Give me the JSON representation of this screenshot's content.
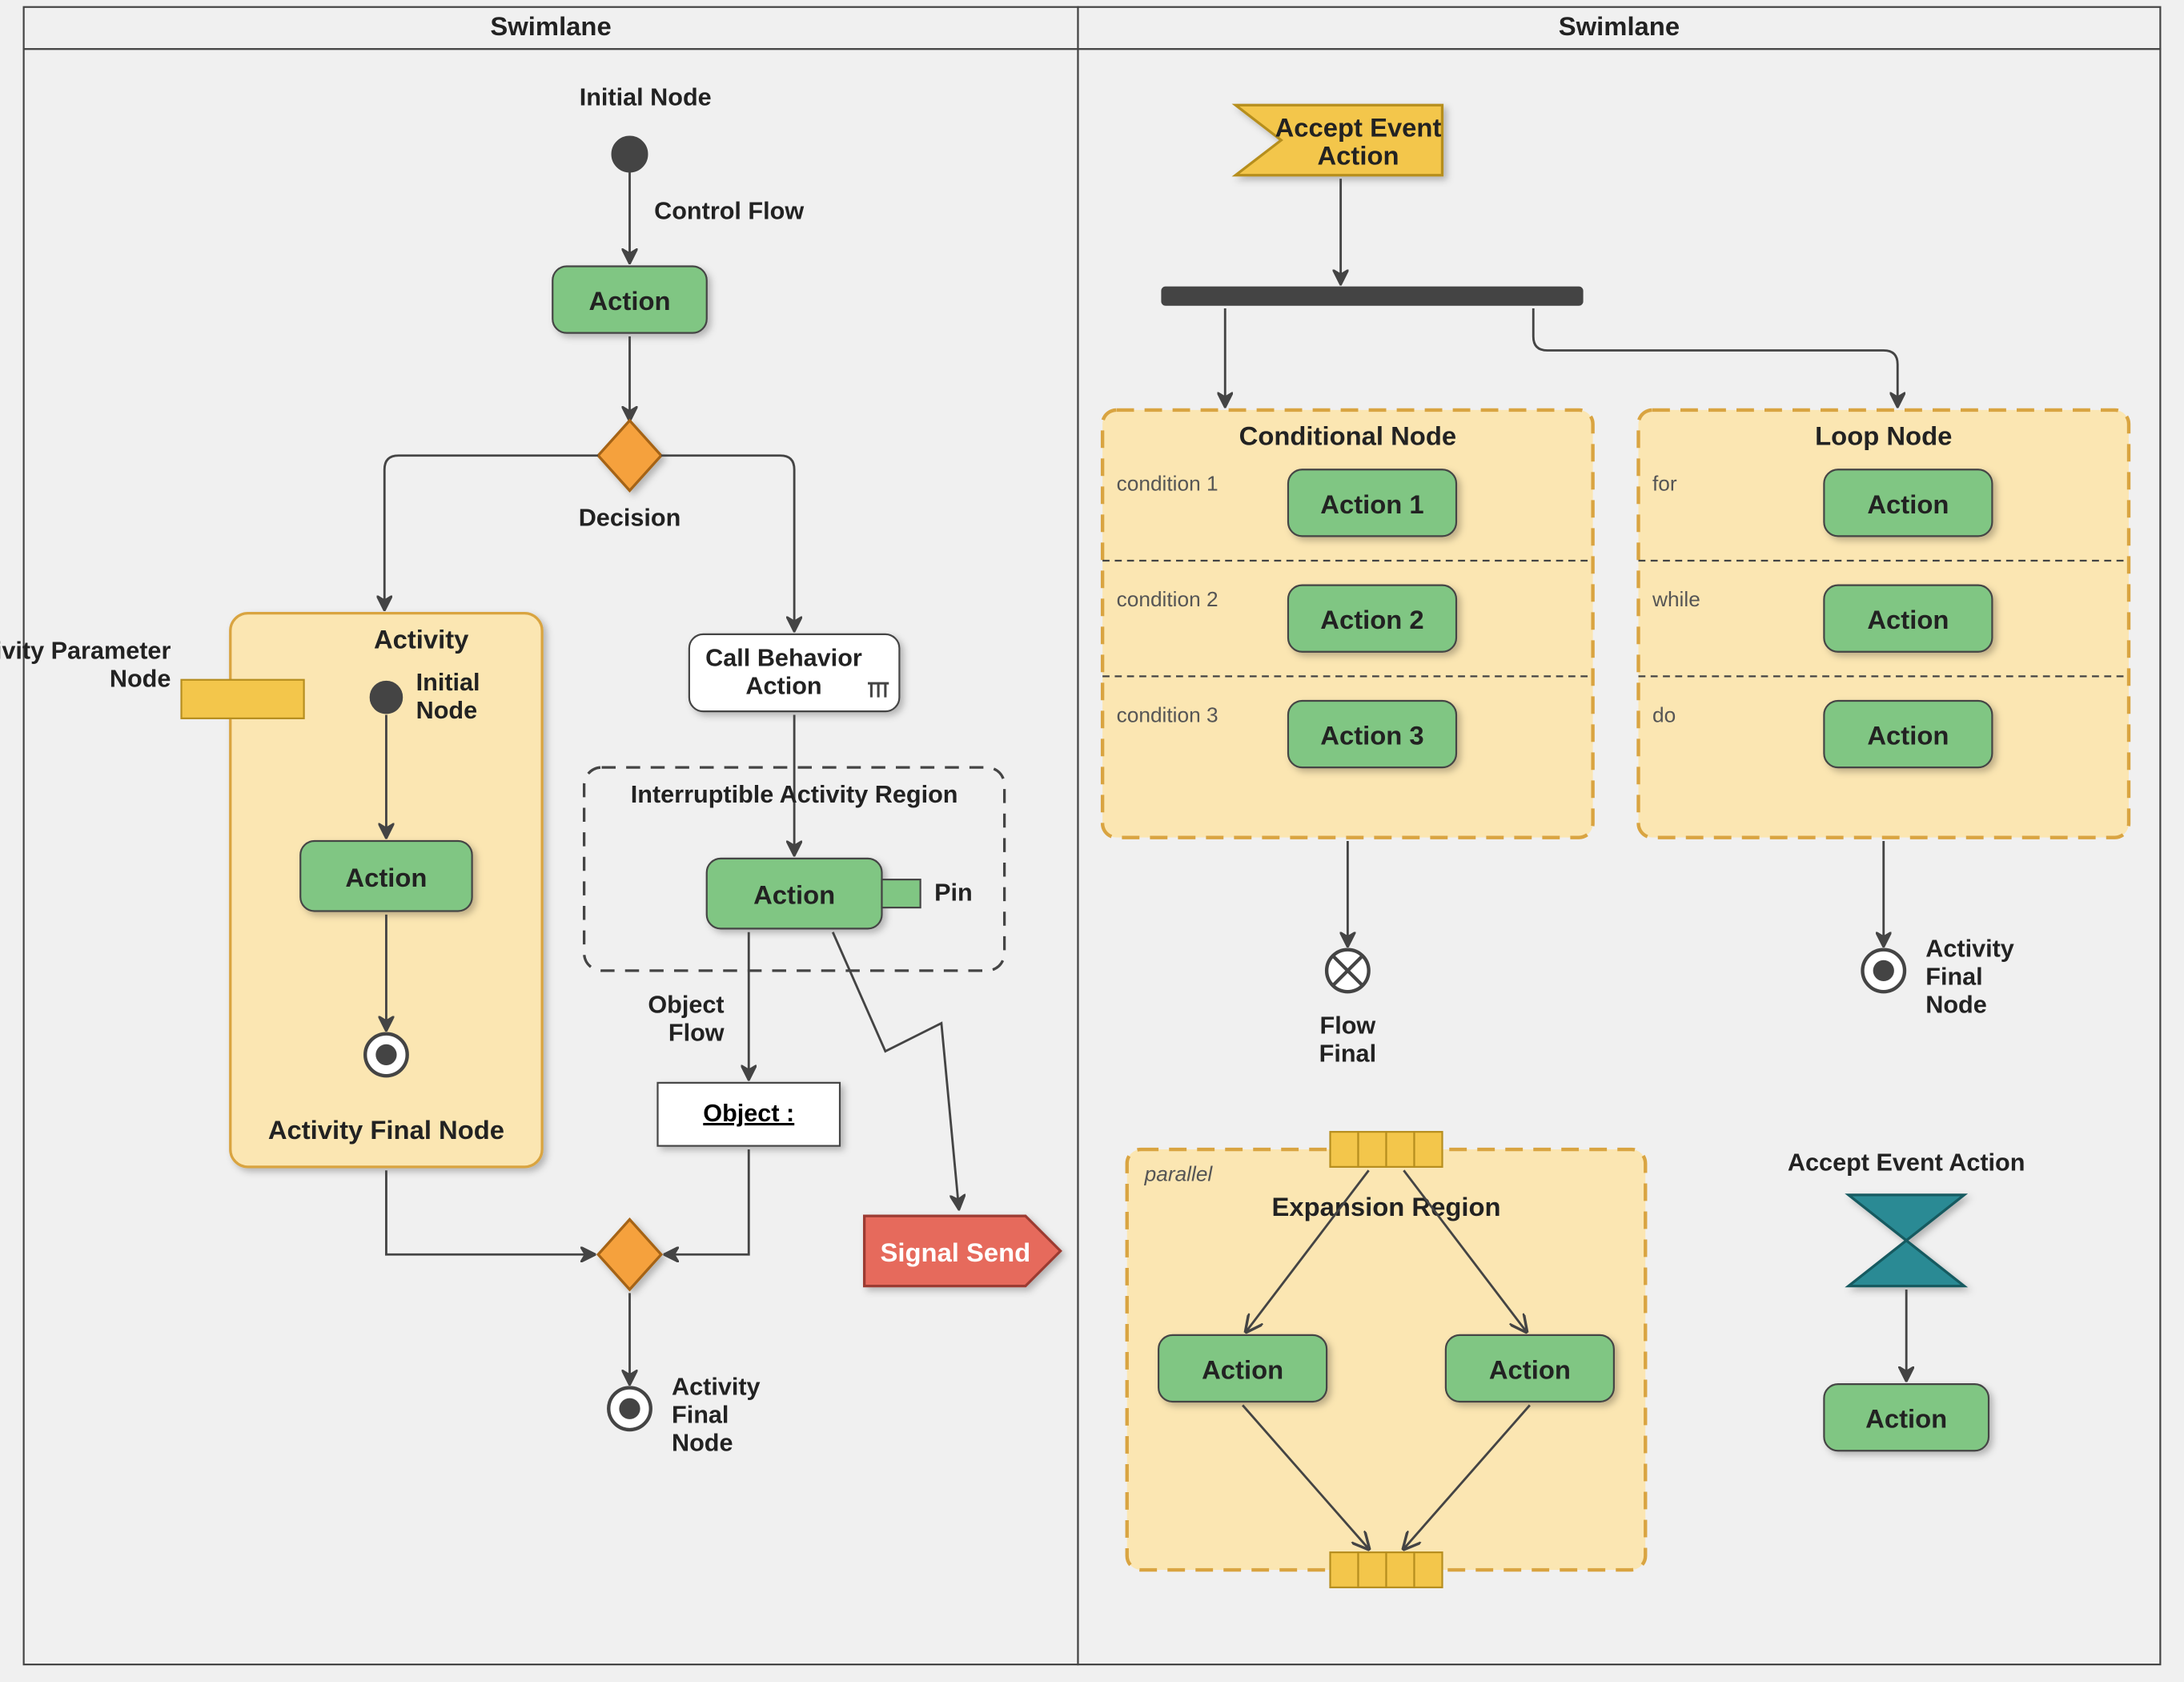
{
  "lanes": {
    "left": "Swimlane",
    "right": "Swimlane"
  },
  "left": {
    "initial": "Initial Node",
    "controlFlow": "Control Flow",
    "action1": "Action",
    "decision": "Decision",
    "paramNode": "Activity Parameter\nNode",
    "activity": {
      "title": "Activity",
      "initial": "Initial\nNode",
      "action": "Action",
      "final": "Activity Final Node"
    },
    "callBehavior": "Call Behavior\nAction",
    "interruptRegion": "Interruptible Activity Region",
    "irAction": "Action",
    "pin": "Pin",
    "objectFlow": "Object\nFlow",
    "object": "Object :",
    "signalSend": "Signal Send",
    "finalBottom": "Activity\nFinal\nNode"
  },
  "right": {
    "acceptEventTop": "Accept Event\nAction",
    "conditional": {
      "title": "Conditional Node",
      "c1": "condition 1",
      "a1": "Action 1",
      "c2": "condition 2",
      "a2": "Action 2",
      "c3": "condition 3",
      "a3": "Action 3"
    },
    "loop": {
      "title": "Loop Node",
      "k1": "for",
      "a1": "Action",
      "k2": "while",
      "a2": "Action",
      "k3": "do",
      "a3": "Action"
    },
    "flowFinal": "Flow\nFinal",
    "activityFinal": "Activity\nFinal\nNode",
    "expansion": {
      "kind": "parallel",
      "title": "Expansion Region",
      "a1": "Action",
      "a2": "Action"
    },
    "acceptEventBottom": "Accept Event Action",
    "bottomAction": "Action"
  }
}
